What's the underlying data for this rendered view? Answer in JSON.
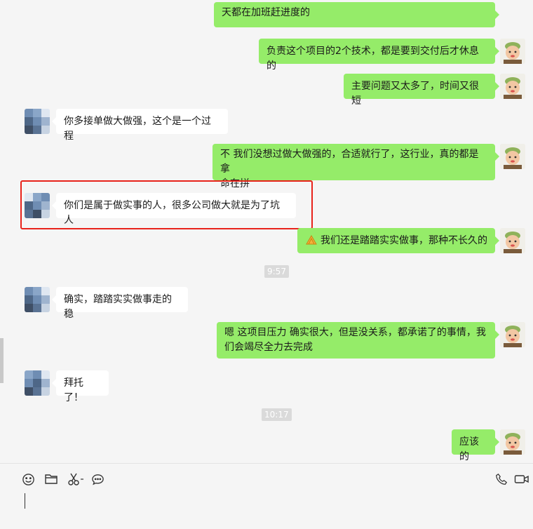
{
  "messages": [
    {
      "text": "天都在加班赶进度的"
    },
    {
      "text": "负责这个项目的2个技术，都是要到交付后才休息的"
    },
    {
      "text": "主要问题又太多了，时间又很短"
    },
    {
      "text": "你多接单做大做强，这个是一个过程"
    },
    {
      "line1": "不 我们没想过做大做强的，合适就行了，这行业，真的都是拿",
      "line2": "命在拼"
    },
    {
      "text": "你们是属于做实事的人，很多公司做大就是为了坑人"
    },
    {
      "text": "我们还是踏踏实实做事，那种不长久的",
      "emoji": "clap-hands-emoji"
    },
    {
      "text": "确实，踏踏实实做事走的稳"
    },
    {
      "line1": "嗯  这项目压力 确实很大，但是没关系，都承诺了的事情，我",
      "line2": "们会竭尽全力去完成"
    },
    {
      "text": "拜托了！"
    },
    {
      "text": "应该的"
    }
  ],
  "timestamps": [
    "9:57",
    "10:17"
  ],
  "composer": {
    "tools": [
      "emoji-icon",
      "folder-icon",
      "scissors-icon",
      "chat-history-icon"
    ],
    "right_tools": [
      "phone-icon",
      "video-icon"
    ]
  },
  "colors": {
    "self_bubble": "#95ec69",
    "other_bubble": "#ffffff",
    "background": "#f5f5f5",
    "highlight": "#e8231b"
  }
}
